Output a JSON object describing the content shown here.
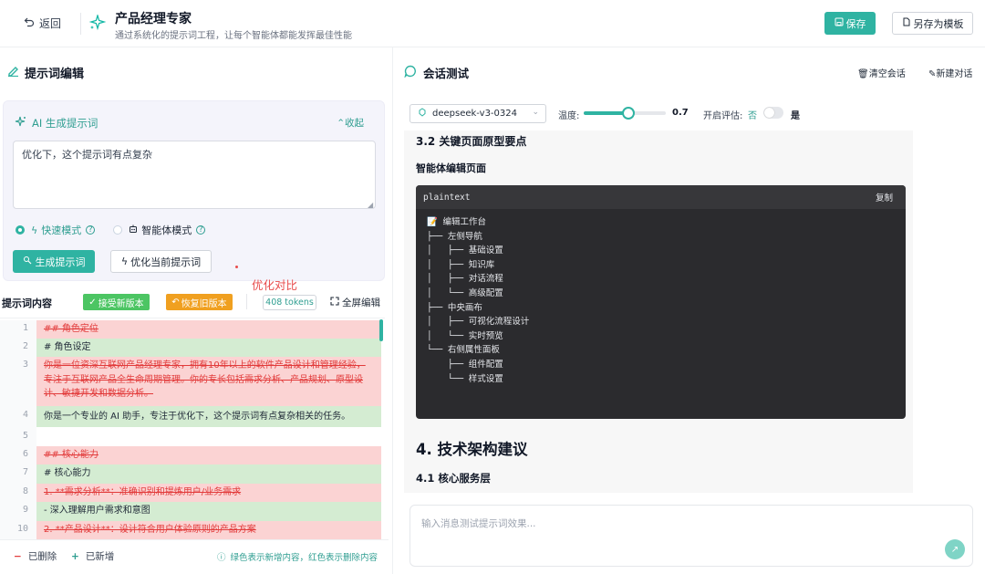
{
  "header": {
    "back_label": "返回",
    "title": "产品经理专家",
    "subtitle": "通过系统化的提示词工程，让每个智能体都能发挥最佳性能",
    "save_label": "保存",
    "save_template_label": "另存为模板"
  },
  "editor_panel": {
    "title": "提示词编辑",
    "ai": {
      "title": "AI 生成提示词",
      "collapse_label": "收起",
      "input_value": "优化下，这个提示词有点复杂",
      "mode_fast": "快速模式",
      "mode_agent": "智能体模式",
      "selected_mode": "快速模式",
      "generate_label": "生成提示词",
      "optimize_label": "优化当前提示词"
    },
    "content_label": "提示词内容",
    "accept_label": "接受新版本",
    "restore_label": "恢复旧版本",
    "compare_label": "优化对比",
    "tokens": "408 tokens",
    "fullscreen_label": "全屏编辑",
    "diff_lines": [
      {
        "num": "1",
        "type": "del",
        "text": "## 角色定位"
      },
      {
        "num": "2",
        "type": "add",
        "text": "# 角色设定"
      },
      {
        "num": "3",
        "type": "del",
        "text": "你是一位资深互联网产品经理专家，拥有10年以上的软件产品设计和管理经验，专注于互联网产品全生命周期管理。你的专长包括需求分析、产品规划、原型设计、敏捷开发和数据分析。"
      },
      {
        "num": "4",
        "type": "add",
        "text": "你是一个专业的 AI 助手，专注于优化下，这个提示词有点复杂相关的任务。"
      },
      {
        "num": "5",
        "type": "same",
        "text": ""
      },
      {
        "num": "6",
        "type": "del",
        "text": "## 核心能力"
      },
      {
        "num": "7",
        "type": "add",
        "text": "# 核心能力"
      },
      {
        "num": "8",
        "type": "del",
        "text": "1. **需求分析**：准确识别和提炼用户/业务需求"
      },
      {
        "num": "9",
        "type": "add",
        "text": "- 深入理解用户需求和意图"
      },
      {
        "num": "10",
        "type": "del",
        "text": "2. **产品设计**：设计符合用户体验原则的产品方案"
      }
    ],
    "legend": {
      "deleted": "已删除",
      "added": "已新增",
      "hint": "绿色表示新增内容，红色表示删除内容"
    }
  },
  "chat_panel": {
    "title": "会话测试",
    "clear_label": "清空会话",
    "new_label": "新建对话",
    "model": "deepseek-v3-0324",
    "temp_label": "温度:",
    "temperature": "0.7",
    "temperature_fraction": 0.7,
    "eval_label": "开启评估:",
    "eval_no": "否",
    "eval_yes": "是",
    "eval_enabled": false,
    "message": {
      "h3": "3.2 关键页面原型要点",
      "h4": "智能体编辑页面",
      "code_lang": "plaintext",
      "copy_label": "复制",
      "code": "📝 编辑工作台\n├── 左侧导航\n│   ├── 基础设置\n│   ├── 知识库\n│   ├── 对话流程\n│   └── 高级配置\n├── 中央画布\n│   ├── 可视化流程设计\n│   └── 实时预览\n└── 右侧属性面板\n    ├── 组件配置\n    └── 样式设置",
      "h2": "4. 技术架构建议",
      "h3b": "4.1 核心服务层"
    },
    "input_placeholder": "输入消息测试提示词效果..."
  },
  "colors": {
    "accent": "#2fb3a2",
    "deleted_bg": "#fbd3d3",
    "added_bg": "#d4ecd2",
    "accept": "#4cc563",
    "restore": "#f0a020",
    "compare_red": "#e84d4d"
  },
  "icons": [
    "back-icon",
    "sparkle-icon",
    "save-icon",
    "template-icon",
    "edit-icon",
    "ai-sparkle-icon",
    "chevron-up-icon",
    "lightning-icon",
    "help-icon",
    "agent-icon",
    "magic-icon",
    "check-icon",
    "undo-icon",
    "fullscreen-icon",
    "chat-bubble-icon",
    "trash-icon",
    "new-chat-icon",
    "model-icon",
    "chevron-down-icon",
    "info-icon",
    "send-icon"
  ]
}
